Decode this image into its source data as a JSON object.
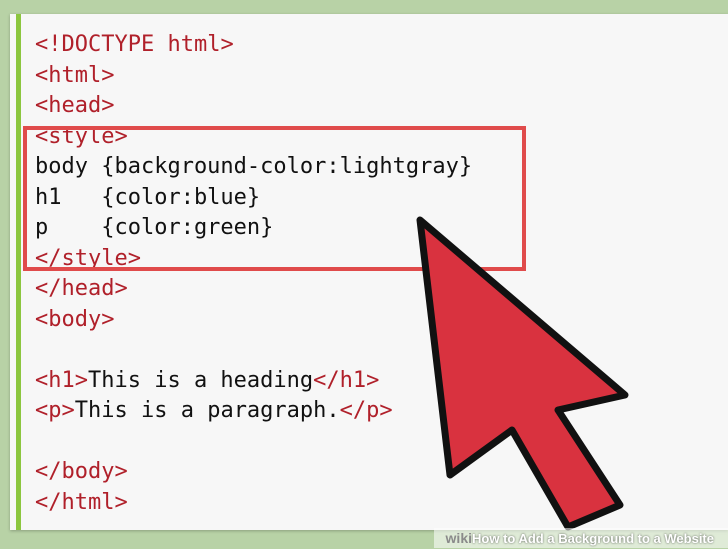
{
  "code_lines": [
    {
      "parts": [
        {
          "t": "<!DOCTYPE ",
          "k": "tag"
        },
        {
          "t": "html",
          "k": "tag"
        },
        {
          "t": ">",
          "k": "tag"
        }
      ]
    },
    {
      "parts": [
        {
          "t": "<html>",
          "k": "tag"
        }
      ]
    },
    {
      "parts": [
        {
          "t": "<head>",
          "k": "tag"
        }
      ]
    },
    {
      "parts": [
        {
          "t": "<style>",
          "k": "tag"
        }
      ]
    },
    {
      "parts": [
        {
          "t": "body {background-color:lightgray}",
          "k": "plain"
        }
      ]
    },
    {
      "parts": [
        {
          "t": "h1   {color:blue}",
          "k": "plain"
        }
      ]
    },
    {
      "parts": [
        {
          "t": "p    {color:green}",
          "k": "plain"
        }
      ]
    },
    {
      "parts": [
        {
          "t": "</style>",
          "k": "tag"
        }
      ]
    },
    {
      "parts": [
        {
          "t": "</head>",
          "k": "tag"
        }
      ]
    },
    {
      "parts": [
        {
          "t": "<body>",
          "k": "tag"
        }
      ]
    },
    {
      "parts": [
        {
          "t": "",
          "k": "plain"
        }
      ]
    },
    {
      "parts": [
        {
          "t": "<h1>",
          "k": "tag"
        },
        {
          "t": "This is a heading",
          "k": "plain"
        },
        {
          "t": "</h1>",
          "k": "tag"
        }
      ]
    },
    {
      "parts": [
        {
          "t": "<p>",
          "k": "tag"
        },
        {
          "t": "This is a paragraph.",
          "k": "plain"
        },
        {
          "t": "</p>",
          "k": "tag"
        }
      ]
    },
    {
      "parts": [
        {
          "t": "",
          "k": "plain"
        }
      ]
    },
    {
      "parts": [
        {
          "t": "</body>",
          "k": "tag"
        }
      ]
    },
    {
      "parts": [
        {
          "t": "</html>",
          "k": "tag"
        }
      ]
    }
  ],
  "caption": {
    "wiki": "wiki",
    "how": "How",
    "rest": " to Add a Background to a Website"
  },
  "colors": {
    "tag": "#b0202a",
    "highlight": "#e04b4b",
    "cursor": "#d9323f",
    "gutter": "#8cc63f"
  },
  "icons": {
    "cursor": "arrow-cursor-icon"
  }
}
